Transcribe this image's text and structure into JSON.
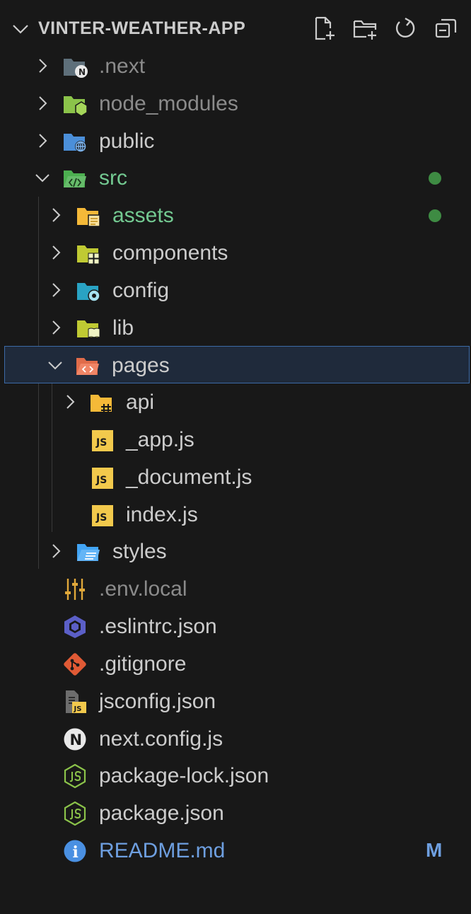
{
  "explorer": {
    "title": "VINTER-WEATHER-APP",
    "actions": [
      {
        "name": "new-file-icon"
      },
      {
        "name": "new-folder-icon"
      },
      {
        "name": "refresh-icon"
      },
      {
        "name": "collapse-all-icon"
      }
    ]
  },
  "tree": {
    "next": {
      "label": ".next",
      "icon": "next-folder-icon"
    },
    "node_modules": {
      "label": "node_modules",
      "icon": "node-folder-icon"
    },
    "public": {
      "label": "public",
      "icon": "public-folder-icon"
    },
    "src": {
      "label": "src",
      "icon": "src-folder-icon"
    },
    "assets": {
      "label": "assets",
      "icon": "assets-folder-icon"
    },
    "components": {
      "label": "components",
      "icon": "components-folder-icon"
    },
    "config": {
      "label": "config",
      "icon": "config-folder-icon"
    },
    "lib": {
      "label": "lib",
      "icon": "lib-folder-icon"
    },
    "pages": {
      "label": "pages",
      "icon": "pages-folder-icon"
    },
    "api": {
      "label": "api",
      "icon": "api-folder-icon"
    },
    "app_js": {
      "label": "_app.js",
      "icon": "js-file-icon",
      "badge": "JS"
    },
    "document_js": {
      "label": "_document.js",
      "icon": "js-file-icon",
      "badge": "JS"
    },
    "index_js": {
      "label": "index.js",
      "icon": "js-file-icon",
      "badge": "JS"
    },
    "styles": {
      "label": "styles",
      "icon": "styles-folder-icon"
    },
    "env_local": {
      "label": ".env.local",
      "icon": "settings-sliders-icon"
    },
    "eslintrc": {
      "label": ".eslintrc.json",
      "icon": "eslint-icon"
    },
    "gitignore": {
      "label": ".gitignore",
      "icon": "git-icon"
    },
    "jsconfig": {
      "label": "jsconfig.json",
      "icon": "jsconfig-icon",
      "badge": "JS"
    },
    "next_config": {
      "label": "next.config.js",
      "icon": "next-logo-icon",
      "badge": "N"
    },
    "package_lock": {
      "label": "package-lock.json",
      "icon": "nodejs-icon"
    },
    "package_json": {
      "label": "package.json",
      "icon": "nodejs-icon"
    },
    "readme": {
      "label": "README.md",
      "icon": "info-icon",
      "badge": "i",
      "status": "M"
    }
  },
  "colors": {
    "background": "#181818",
    "text": "#cccccc",
    "dimmed": "#8b8b8b",
    "modified_green": "#73c991",
    "readme_blue": "#6e9fe0",
    "selection_border": "#3c6aa7"
  }
}
